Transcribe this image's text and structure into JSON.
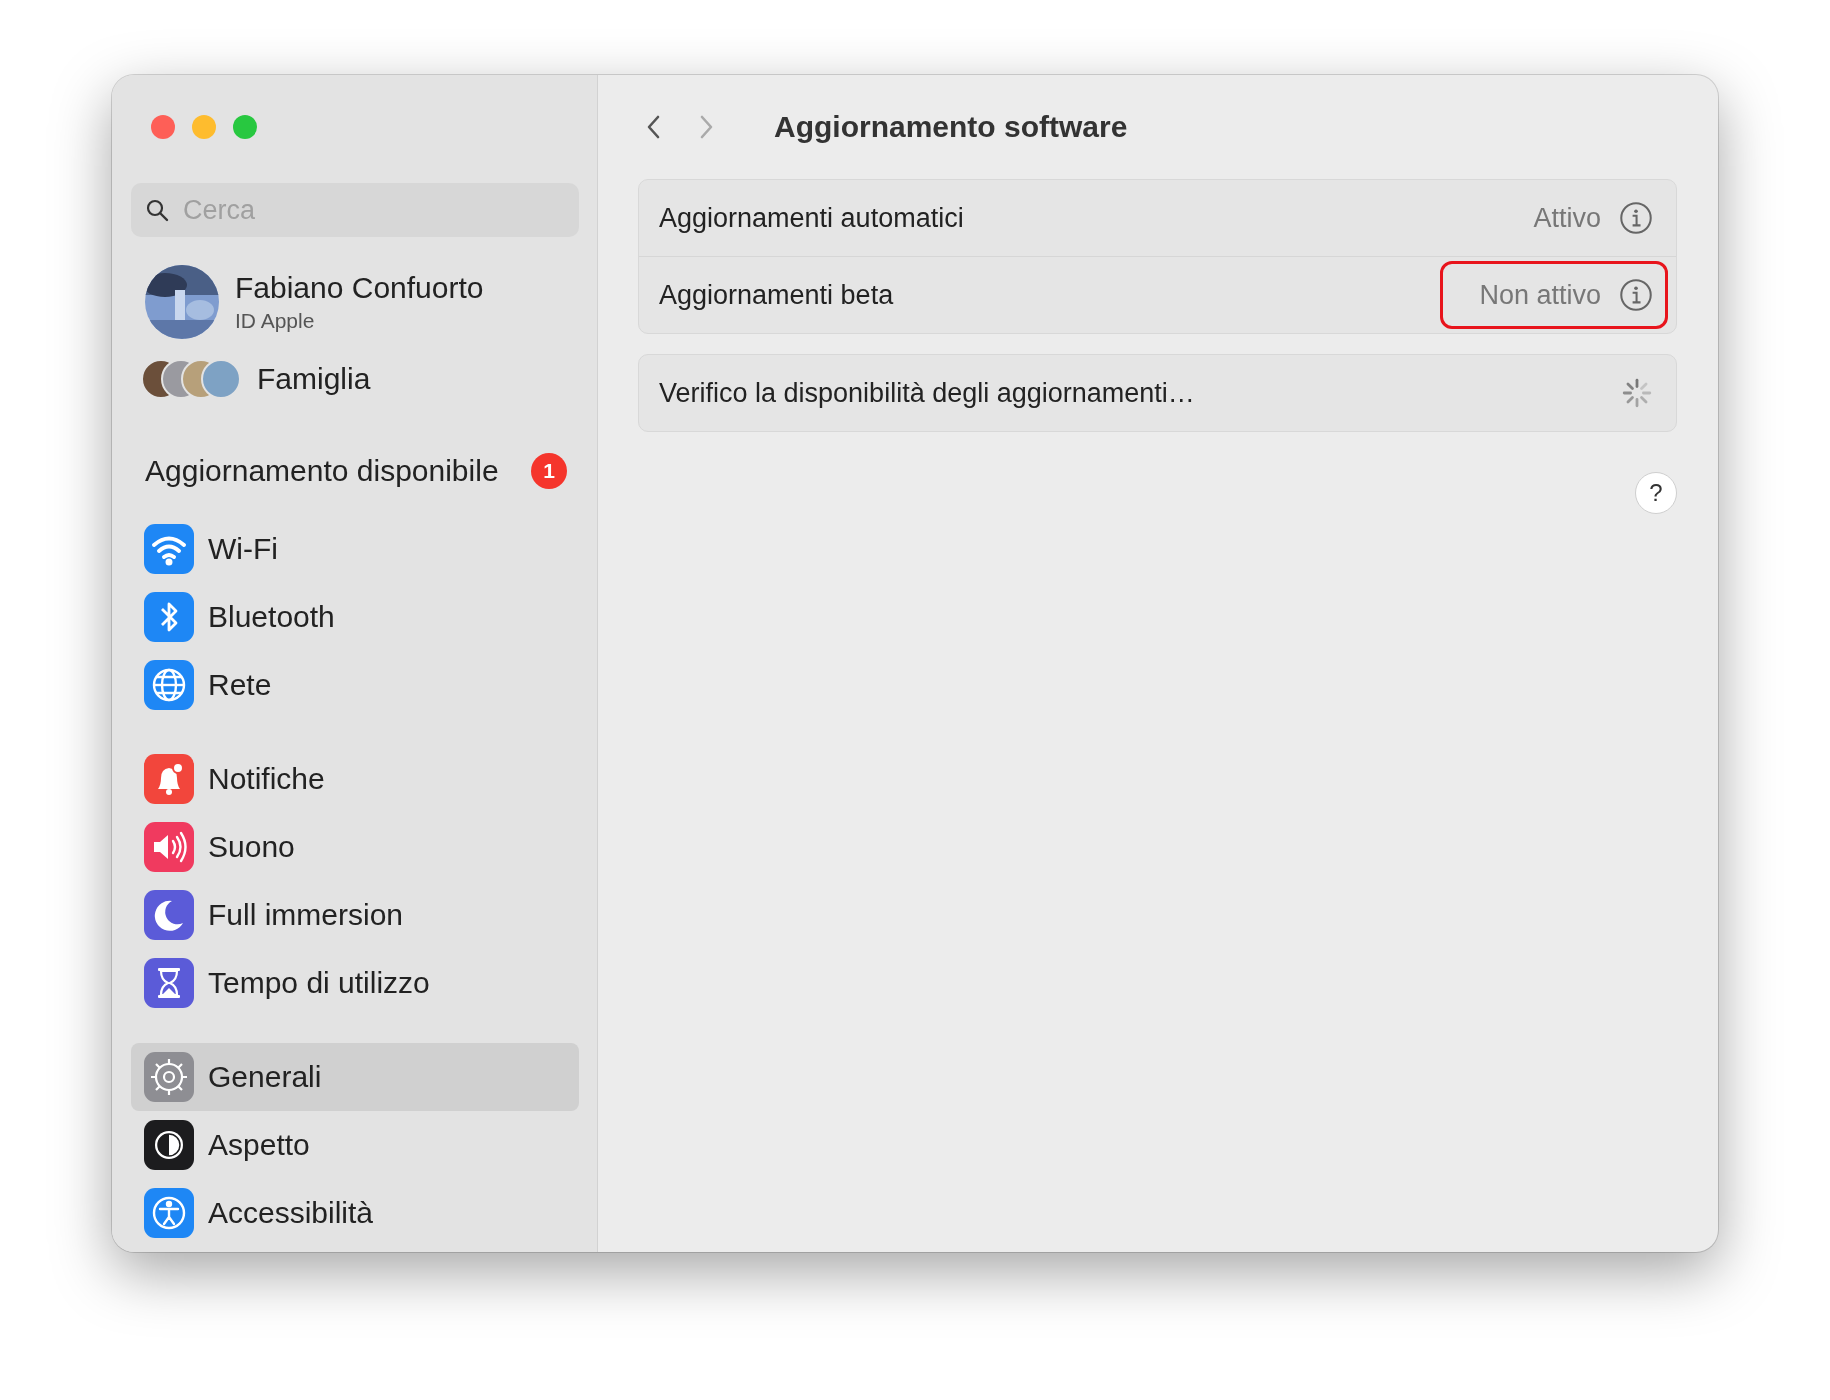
{
  "window": {
    "title": "Aggiornamento software"
  },
  "search": {
    "placeholder": "Cerca"
  },
  "account": {
    "name": "Fabiano Confuorto",
    "subtitle": "ID Apple"
  },
  "family": {
    "label": "Famiglia"
  },
  "update_notice": {
    "label": "Aggiornamento disponibile",
    "badge": "1"
  },
  "sidebar": {
    "groups": [
      {
        "items": [
          {
            "label": "Wi-Fi",
            "kind": "wifi",
            "color": "#1e87f5",
            "selected": false
          },
          {
            "label": "Bluetooth",
            "kind": "bluetooth",
            "color": "#1e87f5",
            "selected": false
          },
          {
            "label": "Rete",
            "kind": "globe",
            "color": "#1e87f5",
            "selected": false
          }
        ]
      },
      {
        "items": [
          {
            "label": "Notifiche",
            "kind": "bell",
            "color": "#f2463c",
            "selected": false
          },
          {
            "label": "Suono",
            "kind": "speaker",
            "color": "#f03a5f",
            "selected": false
          },
          {
            "label": "Full immersion",
            "kind": "moon",
            "color": "#5b5bd8",
            "selected": false
          },
          {
            "label": "Tempo di utilizzo",
            "kind": "hourglass",
            "color": "#5b5bd8",
            "selected": false
          }
        ]
      },
      {
        "items": [
          {
            "label": "Generali",
            "kind": "gear",
            "color": "#8e8e93",
            "selected": true
          },
          {
            "label": "Aspetto",
            "kind": "appearance",
            "color": "#1c1c1e",
            "selected": false
          },
          {
            "label": "Accessibilità",
            "kind": "accessibility",
            "color": "#1e87f5",
            "selected": false
          }
        ]
      }
    ]
  },
  "settings": [
    {
      "rows": [
        {
          "label": "Aggiornamenti automatici",
          "value": "Attivo",
          "kind": "info",
          "highlighted": false
        },
        {
          "label": "Aggiornamenti beta",
          "value": "Non attivo",
          "kind": "info",
          "highlighted": true
        }
      ]
    },
    {
      "rows": [
        {
          "label": "Verifico la disponibilità degli aggiornamenti…",
          "kind": "loading",
          "highlighted": false
        }
      ]
    }
  ],
  "help": {
    "label": "?"
  }
}
